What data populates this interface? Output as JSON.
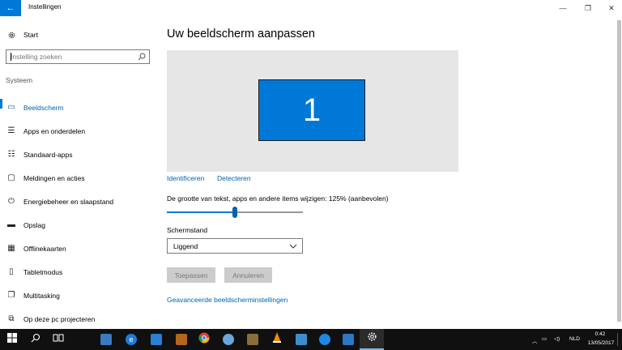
{
  "window": {
    "title": "Instellingen",
    "back_glyph": "←",
    "minimize_glyph": "—",
    "maximize_glyph": "❐",
    "close_glyph": "✕"
  },
  "sidebar": {
    "start_label": "Start",
    "start_icon": "gear-icon",
    "search": {
      "placeholder": "Instelling zoeken",
      "value": ""
    },
    "section_header": "Systeem",
    "items": [
      {
        "label": "Beeldscherm",
        "icon": "display-icon",
        "glyph": "▭",
        "active": true
      },
      {
        "label": "Apps en onderdelen",
        "icon": "apps-list-icon",
        "glyph": "☰",
        "active": false
      },
      {
        "label": "Standaard-apps",
        "icon": "default-apps-icon",
        "glyph": "☷",
        "active": false
      },
      {
        "label": "Meldingen en acties",
        "icon": "notifications-icon",
        "glyph": "▢",
        "active": false
      },
      {
        "label": "Energiebeheer en slaapstand",
        "icon": "power-icon",
        "glyph": "⏻",
        "active": false
      },
      {
        "label": "Opslag",
        "icon": "storage-icon",
        "glyph": "▬",
        "active": false
      },
      {
        "label": "Offlinekaarten",
        "icon": "map-icon",
        "glyph": "▦",
        "active": false
      },
      {
        "label": "Tabletmodus",
        "icon": "tablet-icon",
        "glyph": "▯",
        "active": false
      },
      {
        "label": "Multitasking",
        "icon": "multitasking-icon",
        "glyph": "❐",
        "active": false
      },
      {
        "label": "Op deze pc projecteren",
        "icon": "project-icon",
        "glyph": "⧉",
        "active": false
      }
    ]
  },
  "main": {
    "title": "Uw beeldscherm aanpassen",
    "monitor_number": "1",
    "identify_link": "Identificeren",
    "detect_link": "Detecteren",
    "scale_label": "De grootte van tekst, apps en andere items wijzigen:  125% (aanbevolen)",
    "scale_slider_fraction": 0.5,
    "orientation_label": "Schermstand",
    "orientation_value": "Liggend",
    "apply_button": "Toepassen",
    "cancel_button": "Annuleren",
    "advanced_link": "Geavanceerde beeldscherminstellingen"
  },
  "taskbar": {
    "icons": [
      "windows-start-icon",
      "search-icon",
      "task-view-icon",
      "notepad-icon",
      "edge-icon",
      "store-icon",
      "photos-icon",
      "chrome-icon",
      "paint-icon",
      "sumatra-icon",
      "vlc-icon",
      "teamviewer-icon",
      "browser-icon",
      "mail-icon",
      "settings-icon"
    ],
    "tray_language": "NLD",
    "time": "0:42",
    "date": "13/05/2017"
  },
  "colors": {
    "accent": "#0078d7",
    "link": "#0063b1",
    "preview_background": "#e6e6e6",
    "taskbar": "#101010"
  }
}
